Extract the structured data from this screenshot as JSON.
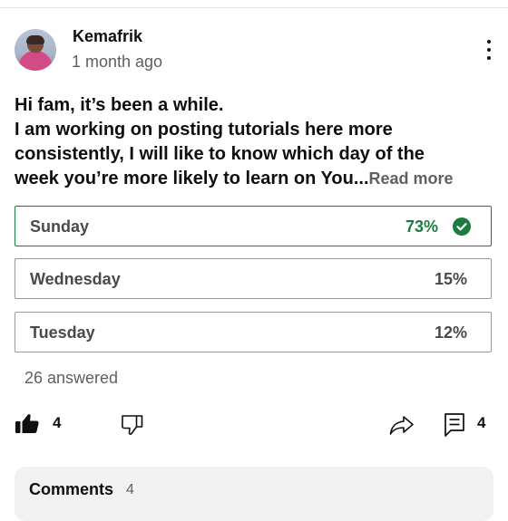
{
  "post": {
    "channel_name": "Kemafrik",
    "time_ago": "1 month ago",
    "text_lines": [
      "Hi fam, it’s been a while.",
      "I am working on posting tutorials here more",
      "consistently, I will like to know which day of the",
      "week you’re more likely to learn on You..."
    ],
    "read_more_label": "Read more"
  },
  "poll": {
    "options": [
      {
        "label": "Sunday",
        "percent": "73%",
        "selected": true
      },
      {
        "label": "Wednesday",
        "percent": "15%",
        "selected": false
      },
      {
        "label": "Tuesday",
        "percent": "12%",
        "selected": false
      }
    ],
    "answered_text": "26 answered"
  },
  "actions": {
    "like_count": "4",
    "comment_count": "4"
  },
  "comments": {
    "title": "Comments",
    "count": "4"
  },
  "icons": {
    "more": "more-vert-icon",
    "check": "check-circle-icon",
    "like": "thumb-up-filled-icon",
    "dislike": "thumb-down-outline-icon",
    "share": "share-arrow-icon",
    "comment": "comment-bubble-icon"
  },
  "colors": {
    "selected_accent": "#1e7a3e",
    "secondary_text": "#606060",
    "primary_text": "#0f0f0f",
    "comments_bg": "#f1f1f1"
  }
}
